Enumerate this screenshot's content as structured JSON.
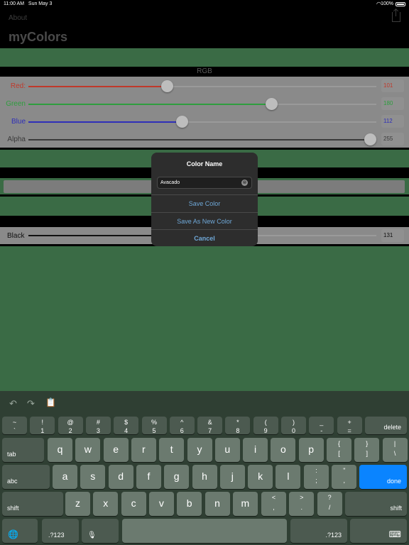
{
  "status_bar": {
    "time": "11:00 AM",
    "date": "Sun May 3",
    "battery": "100%"
  },
  "nav": {
    "about": "About",
    "title": "myColors"
  },
  "rgb": {
    "header": "RGB",
    "rows": [
      {
        "label": "Red:",
        "value": "101",
        "level": 0.396,
        "color": "#c0392b"
      },
      {
        "label": "Green",
        "value": "180",
        "level": 0.706,
        "color": "#2e9e3e"
      },
      {
        "label": "Blue",
        "value": "112",
        "level": 0.439,
        "color": "#2f2fb8"
      },
      {
        "label": "Alpha",
        "value": "255",
        "level": 1.0,
        "color": "#3a3a3a"
      }
    ]
  },
  "black_row": {
    "label": "Black",
    "value": "131",
    "level": 0.514,
    "color": "#111111"
  },
  "modal": {
    "title": "Color Name",
    "input_value": "Avacado",
    "clear_icon": "⊗",
    "buttons": [
      "Save Color",
      "Save As New Color",
      "Cancel"
    ]
  },
  "keyboard": {
    "toolbar": {
      "undo": "↶",
      "redo": "↷",
      "paste": "📋"
    },
    "row1": [
      [
        "~",
        "`"
      ],
      [
        "!",
        "1"
      ],
      [
        "@",
        "2"
      ],
      [
        "#",
        "3"
      ],
      [
        "$",
        "4"
      ],
      [
        "%",
        "5"
      ],
      [
        "^",
        "6"
      ],
      [
        "&",
        "7"
      ],
      [
        "*",
        "8"
      ],
      [
        "(",
        "9"
      ],
      [
        ")",
        "0"
      ],
      [
        "_",
        "-"
      ],
      [
        "+",
        "="
      ]
    ],
    "delete": "delete",
    "tab": "tab",
    "row2": [
      "q",
      "w",
      "e",
      "r",
      "t",
      "y",
      "u",
      "i",
      "o",
      "p"
    ],
    "row2_sym": [
      [
        "{",
        "["
      ],
      [
        "}",
        "]"
      ],
      [
        "|",
        "\\"
      ]
    ],
    "abc": "abc",
    "row3": [
      "a",
      "s",
      "d",
      "f",
      "g",
      "h",
      "j",
      "k",
      "l"
    ],
    "row3_sym": [
      [
        ":",
        ";"
      ],
      [
        "\"",
        ","
      ]
    ],
    "done": "done",
    "shift": "shift",
    "row4": [
      "z",
      "x",
      "c",
      "v",
      "b",
      "n",
      "m"
    ],
    "row4_sym": [
      [
        "<",
        ","
      ],
      [
        ">",
        "."
      ],
      [
        "?",
        "/"
      ]
    ],
    "shift_right": "shift",
    "globe": "🌐",
    "num_left": ".?123",
    "mic": "🎙",
    "num_right": ".?123",
    "hide": "⌨"
  },
  "colors": {
    "background": "#3a6b45",
    "accent_blue": "#0a84ff",
    "modal_link": "#6fa8d8"
  }
}
